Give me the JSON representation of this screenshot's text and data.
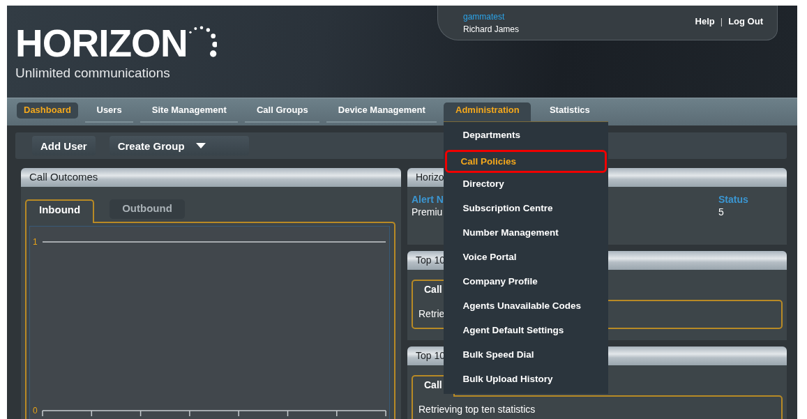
{
  "logo": {
    "name": "HORIZON",
    "tagline": "Unlimited communications"
  },
  "user": {
    "account": "gammatest",
    "name": "Richard James"
  },
  "header_links": [
    {
      "label": "Help"
    },
    {
      "label": "Log Out"
    }
  ],
  "link_separator": "|",
  "nav": [
    {
      "label": "Dashboard",
      "selected": true,
      "expanded": false
    },
    {
      "label": "Users",
      "selected": false,
      "expanded": false
    },
    {
      "label": "Site Management",
      "selected": false,
      "expanded": false
    },
    {
      "label": "Call Groups",
      "selected": false,
      "expanded": false
    },
    {
      "label": "Device Management",
      "selected": false,
      "expanded": false
    },
    {
      "label": "Administration",
      "selected": false,
      "expanded": true
    },
    {
      "label": "Statistics",
      "selected": false,
      "expanded": false
    }
  ],
  "admin_menu": [
    {
      "label": "Departments",
      "selected": false
    },
    {
      "label": "Call Policies",
      "selected": true
    },
    {
      "label": "Directory",
      "selected": false
    },
    {
      "label": "Subscription Centre",
      "selected": false
    },
    {
      "label": "Number Management",
      "selected": false
    },
    {
      "label": "Voice Portal",
      "selected": false
    },
    {
      "label": "Company Profile",
      "selected": false
    },
    {
      "label": "Agents Unavailable Codes",
      "selected": false
    },
    {
      "label": "Agent Default Settings",
      "selected": false
    },
    {
      "label": "Bulk Speed Dial",
      "selected": false
    },
    {
      "label": "Bulk Upload History",
      "selected": false
    }
  ],
  "toolbar": [
    {
      "label": "Add User",
      "kind": "button"
    },
    {
      "label": "Create Group",
      "kind": "dropdown"
    }
  ],
  "call_outcomes": {
    "title": "Call Outcomes",
    "tabs": [
      {
        "label": "Inbound",
        "selected": true
      },
      {
        "label": "Outbound",
        "selected": false
      }
    ],
    "chart": {
      "y_tick_labels": [
        "1",
        "0"
      ]
    }
  },
  "alerts": {
    "title": "Horizo",
    "columns": [
      "Alert N",
      "Status"
    ],
    "rows": [
      [
        "Premiu",
        "5"
      ]
    ]
  },
  "top_callers": [
    {
      "title": "Top 10",
      "tabs": [
        {
          "label": "Call",
          "selected": true
        }
      ],
      "message": "Retrie"
    },
    {
      "title": "Top 10",
      "tabs": [
        {
          "label": "Call",
          "selected": true
        }
      ],
      "message": "Retrieving top ten statistics"
    }
  ]
}
